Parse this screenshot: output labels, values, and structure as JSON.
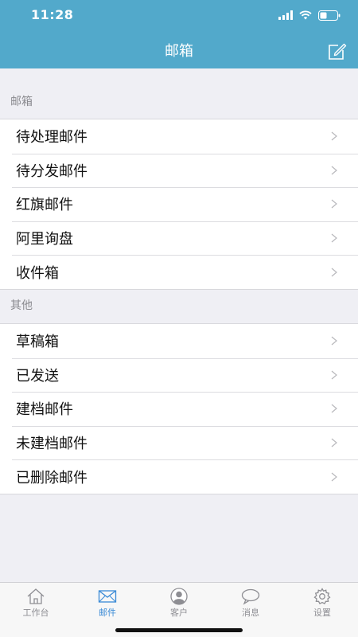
{
  "status_bar": {
    "time": "11:28"
  },
  "header": {
    "title": "邮箱",
    "compose_icon": "compose-icon"
  },
  "sections": [
    {
      "title": "邮箱",
      "items": [
        {
          "label": "待处理邮件"
        },
        {
          "label": "待分发邮件"
        },
        {
          "label": "红旗邮件"
        },
        {
          "label": "阿里询盘"
        },
        {
          "label": "收件箱"
        }
      ]
    },
    {
      "title": "其他",
      "items": [
        {
          "label": "草稿箱"
        },
        {
          "label": "已发送"
        },
        {
          "label": "建档邮件"
        },
        {
          "label": "未建档邮件"
        },
        {
          "label": "已删除邮件"
        }
      ]
    }
  ],
  "tabbar": {
    "active": "mail",
    "tabs": [
      {
        "label": "工作台",
        "icon": "home-icon"
      },
      {
        "label": "邮件",
        "icon": "mail-icon"
      },
      {
        "label": "客户",
        "icon": "user-icon"
      },
      {
        "label": "消息",
        "icon": "chat-bubble-icon"
      },
      {
        "label": "设置",
        "icon": "gear-icon"
      }
    ]
  },
  "colors": {
    "header_bg": "#52a9cb",
    "page_bg": "#efeff4",
    "active_tab": "#3b8bd6",
    "inactive_tab": "#8e8e93"
  }
}
